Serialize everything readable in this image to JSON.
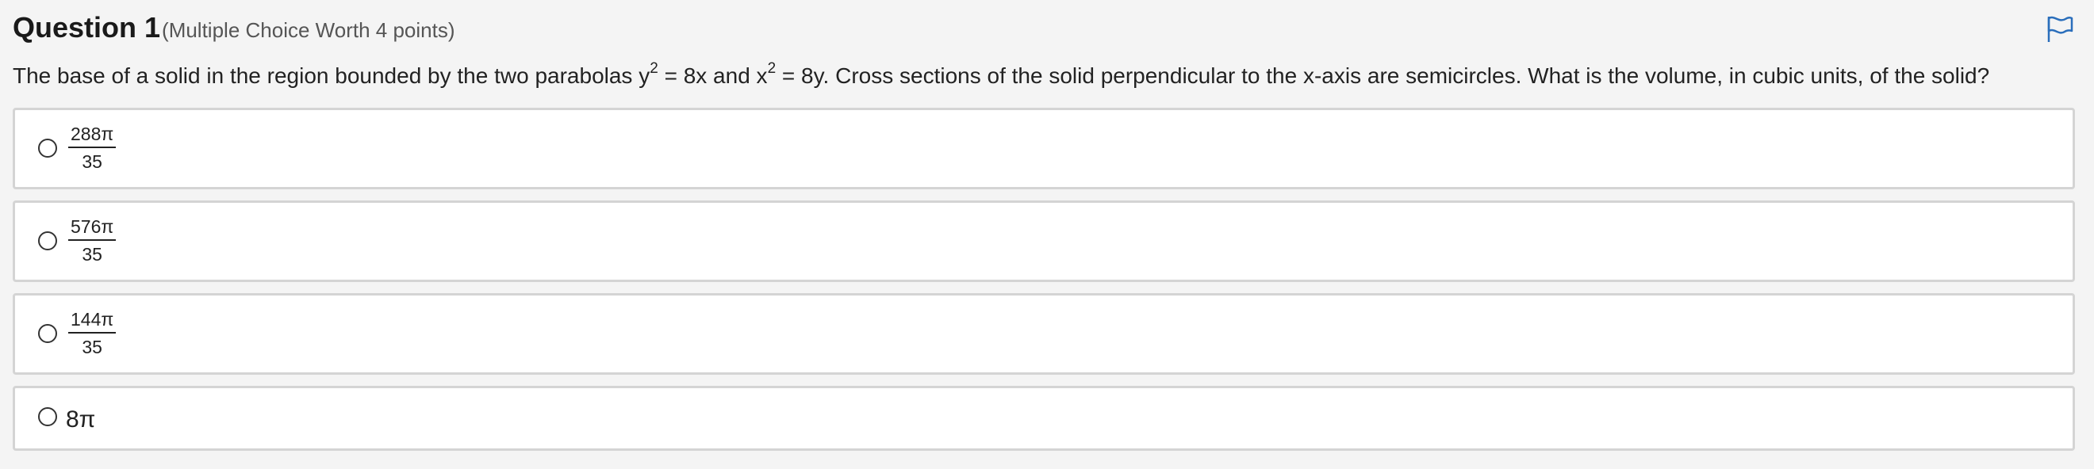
{
  "question": {
    "title": "Question 1",
    "subtitle": "(Multiple Choice Worth 4 points)",
    "text_part1": "The base of a solid in the region bounded by the two parabolas y",
    "sup1": "2",
    "text_part2": " = 8x and x",
    "sup2": "2",
    "text_part3": " = 8y. Cross sections of the solid perpendicular to the x-axis are semicircles. What is the volume, in cubic units, of the solid?"
  },
  "flag": {
    "icon": "flag-icon",
    "color": "#2a6ebb"
  },
  "options": [
    {
      "numerator": "288π",
      "denominator": "35"
    },
    {
      "numerator": "576π",
      "denominator": "35"
    },
    {
      "numerator": "144π",
      "denominator": "35"
    },
    {
      "text": "8π"
    }
  ],
  "colors": {
    "background": "#f4f4f4",
    "option_border": "#d4d4d4",
    "option_background": "#ffffff"
  }
}
